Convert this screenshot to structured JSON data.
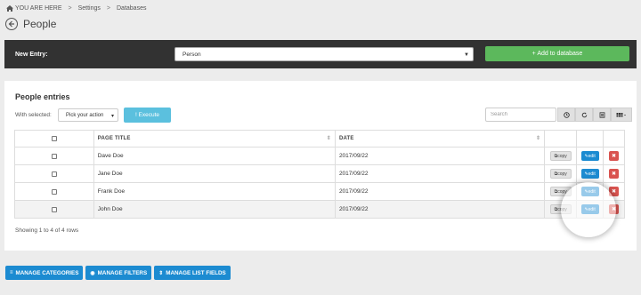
{
  "breadcrumb": {
    "home_label": "YOU ARE HERE",
    "items": [
      "Settings",
      "Databases"
    ],
    "separator": ">"
  },
  "page": {
    "title": "People"
  },
  "new_entry": {
    "label": "New Entry:",
    "selected_type": "Person",
    "add_button": "+ Add to database"
  },
  "panel": {
    "title": "People entries",
    "with_selected_label": "With selected:",
    "action_select_value": "Pick your action",
    "execute_label": "! Execute",
    "search_placeholder": "Search",
    "toolbar_icons": [
      "clock-icon",
      "refresh-icon",
      "list-icon",
      "grid-icon"
    ]
  },
  "table": {
    "columns": [
      "",
      "PAGE TITLE",
      "DATE",
      "",
      "",
      ""
    ],
    "rows": [
      {
        "title": "Dave Doe",
        "date": "2017/09/22"
      },
      {
        "title": "Jane Doe",
        "date": "2017/09/22"
      },
      {
        "title": "Frank Doe",
        "date": "2017/09/22"
      },
      {
        "title": "John Doe",
        "date": "2017/09/22"
      }
    ],
    "copy_label": "copy",
    "edit_label": "edit",
    "delete_symbol": "✖",
    "footer": "Showing 1 to 4 of 4 rows"
  },
  "bottom_buttons": [
    {
      "icon": "≡",
      "label": "MANAGE CATEGORIES"
    },
    {
      "icon": "◉",
      "label": "MANAGE FILTERS"
    },
    {
      "icon": "⇕",
      "label": "MANAGE LIST FIELDS"
    }
  ],
  "colors": {
    "primary": "#1c8bd1",
    "success": "#5cb85c",
    "info": "#5bc0de",
    "danger": "#d9534f",
    "dark_bar": "#323232"
  }
}
